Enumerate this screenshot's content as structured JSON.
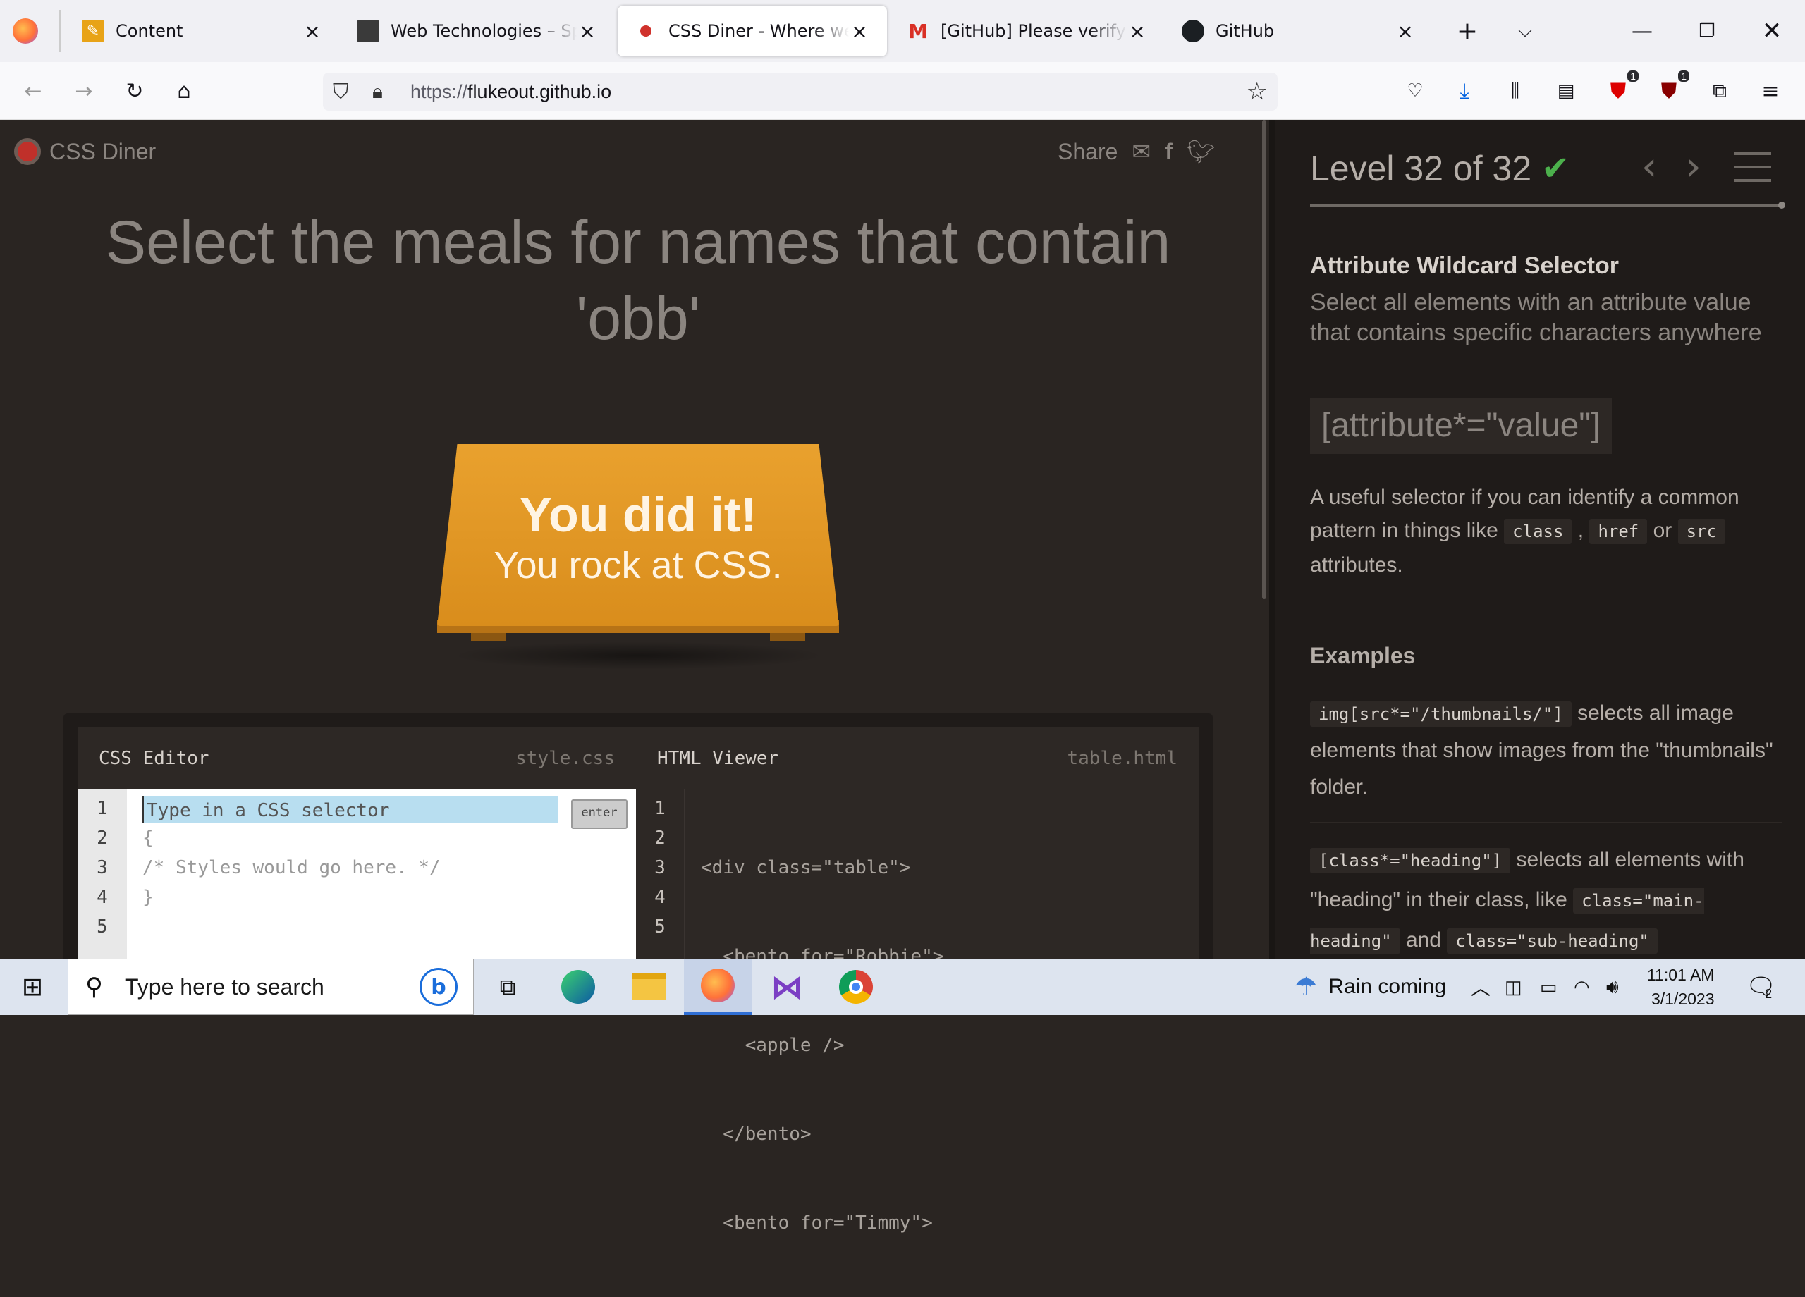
{
  "browser": {
    "tabs": [
      {
        "title": "Content",
        "favicon_color": "#e8a317"
      },
      {
        "title": "Web Technologies – Spring",
        "favicon_color": "#3a3a3a"
      },
      {
        "title": "CSS Diner - Where we feast",
        "favicon_color": "#d0322c",
        "active": true
      },
      {
        "title": "[GitHub] Please verify your",
        "favicon_color": "#d93025"
      },
      {
        "title": "GitHub",
        "favicon_color": "#1b1f23"
      }
    ],
    "url_prefix": "https://",
    "url_host": "flukeout.github.io",
    "badges": {
      "ext1": "1",
      "ext2": "1"
    }
  },
  "game": {
    "logo": "CSS Diner",
    "share_label": "Share",
    "instruction": "Select the meals for names that contain 'obb'",
    "table_msg_1": "You did it!",
    "table_msg_2": "You rock at CSS.",
    "css_editor": {
      "title": "CSS Editor",
      "filename": "style.css",
      "placeholder": "Type in a CSS selector",
      "enter_label": "enter",
      "lines": [
        "",
        "{",
        "/* Styles would go here. */",
        "}",
        ""
      ],
      "line_numbers": [
        "1",
        "2",
        "3",
        "4",
        "5"
      ]
    },
    "html_viewer": {
      "title": "HTML Viewer",
      "filename": "table.html",
      "lines": [
        "<div class=\"table\">",
        "  <bento for=\"Robbie\">",
        "    <apple />",
        "  </bento>",
        "  <bento for=\"Timmy\">"
      ],
      "line_numbers": [
        "1",
        "2",
        "3",
        "4",
        "5"
      ]
    }
  },
  "sidebar": {
    "level": "Level 32 of 32",
    "selector_name": "Attribute Wildcard Selector",
    "selector_desc": "Select all elements with an attribute value that contains specific characters anywhere",
    "syntax": "[attribute*=\"value\"]",
    "help_pre": "A useful selector if you can identify a common pattern in things like",
    "help_tags": [
      "class",
      "href",
      "src"
    ],
    "help_or": "or",
    "help_post": "attributes.",
    "examples_title": "Examples",
    "ex1_code": "img[src*=\"/thumbnails/\"]",
    "ex1_text": "selects all image elements that show images from the \"thumbnails\" folder.",
    "ex2_code": "[class*=\"heading\"]",
    "ex2_text": "selects all elements with \"heading\" in their class, like",
    "ex2_tag1": "class=\"main-heading\"",
    "ex2_and": "and",
    "ex2_tag2": "class=\"sub-heading\""
  },
  "taskbar": {
    "search_placeholder": "Type here to search",
    "weather": "Rain coming",
    "time": "11:01 AM",
    "date": "3/1/2023",
    "notif_count": "2"
  }
}
